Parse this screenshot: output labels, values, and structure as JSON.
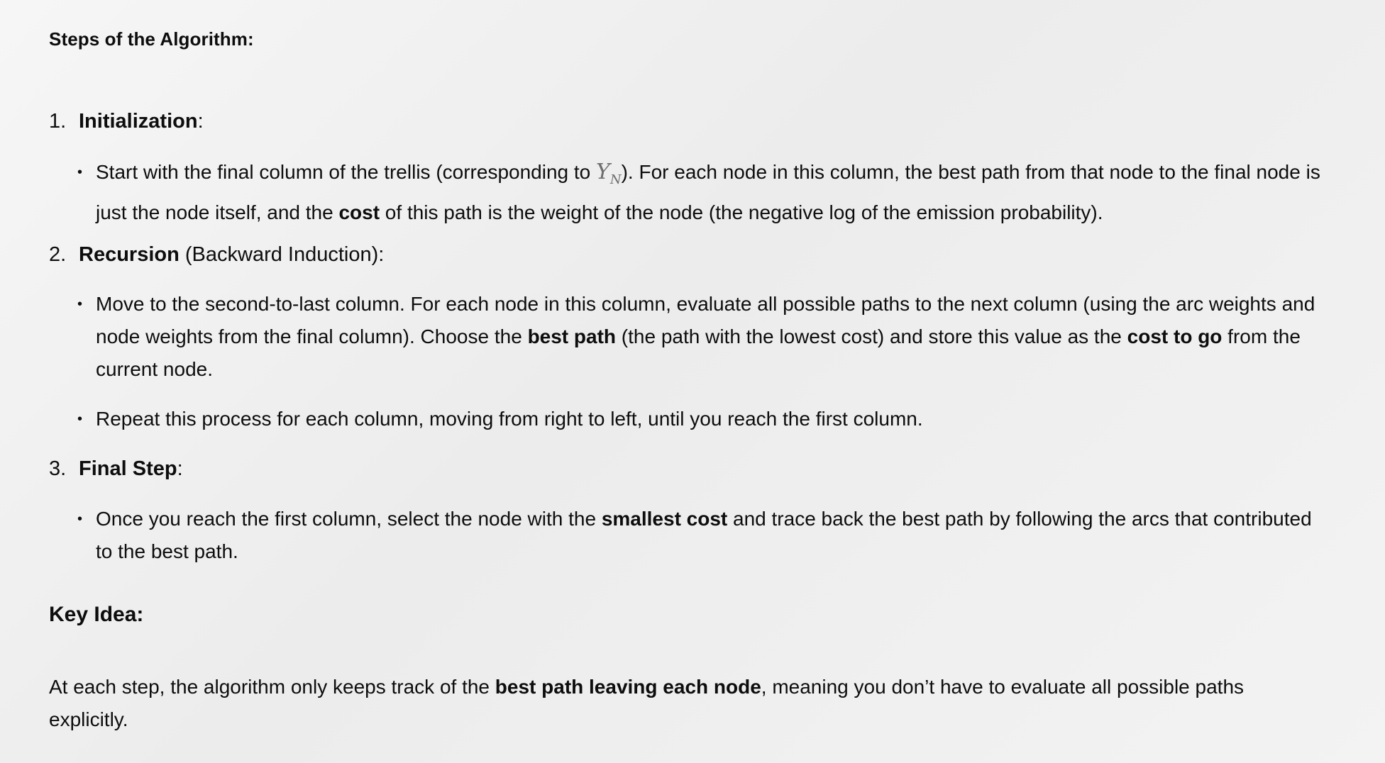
{
  "heading": "Steps of the Algorithm:",
  "steps": [
    {
      "number": "1.",
      "title": "Initialization",
      "suffix": ":",
      "bullets": [
        {
          "t1": "Start with the final column of the trellis (corresponding to ",
          "math_base": "Y",
          "math_sub": "N",
          "t2": "). For each node in this column, the best path from that node to the final node is just the node itself, and the ",
          "b1": "cost",
          "t3": " of this path is the weight of the node (the negative log of the emission probability)."
        }
      ]
    },
    {
      "number": "2.",
      "title": "Recursion",
      "suffix": " (Backward Induction):",
      "bullets": [
        {
          "t1": "Move to the second-to-last column. For each node in this column, evaluate all possible paths to the next column (using the arc weights and node weights from the final column). Choose the ",
          "b1": "best path",
          "t2": " (the path with the lowest cost) and store this value as the ",
          "b2": "cost to go",
          "t3": " from the current node."
        },
        {
          "t1": "Repeat this process for each column, moving from right to left, until you reach the first column."
        }
      ]
    },
    {
      "number": "3.",
      "title": "Final Step",
      "suffix": ":",
      "bullets": [
        {
          "t1": "Once you reach the first column, select the node with the ",
          "b1": "smallest cost",
          "t2": " and trace back the best path by following the arcs that contributed to the best path."
        }
      ]
    }
  ],
  "key_idea": {
    "heading": "Key Idea:",
    "t1": "At each step, the algorithm only keeps track of the ",
    "b1": "best path leaving each node",
    "t2": ", meaning you don’t have to evaluate all possible paths explicitly."
  }
}
